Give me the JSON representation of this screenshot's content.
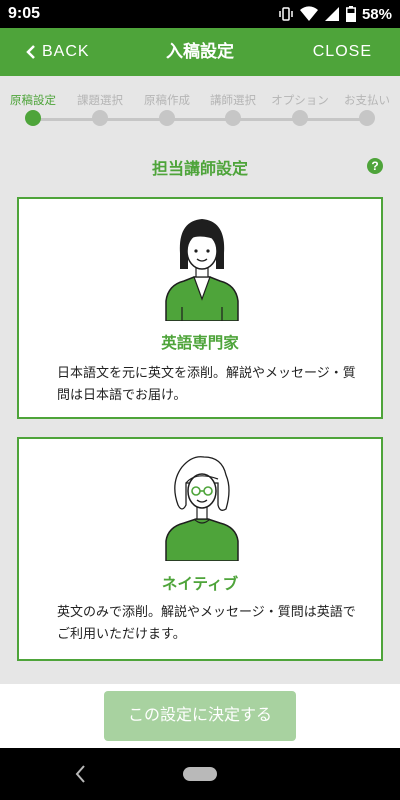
{
  "status_bar": {
    "time": "9:05",
    "battery": "58%"
  },
  "app_bar": {
    "back_label": "BACK",
    "title": "入稿設定",
    "close_label": "CLOSE"
  },
  "steps": [
    {
      "label": "原稿設定",
      "active": true
    },
    {
      "label": "課題選択",
      "active": false
    },
    {
      "label": "原稿作成",
      "active": false
    },
    {
      "label": "講師選択",
      "active": false
    },
    {
      "label": "オプション",
      "active": false
    },
    {
      "label": "お支払い",
      "active": false
    }
  ],
  "section": {
    "title": "担当講師設定",
    "help_icon": "?"
  },
  "options": [
    {
      "title": "英語専門家",
      "description": "日本語文を元に英文を添削。解説やメッセージ・質問は日本語でお届け。",
      "avatar": "female-teacher-avatar"
    },
    {
      "title": "ネイティブ",
      "description": "英文のみで添削。解説やメッセージ・質問は英語でご利用いただけます。",
      "avatar": "native-teacher-avatar"
    }
  ],
  "submit": {
    "label": "この設定に決定する"
  },
  "colors": {
    "accent": "#4ea43a",
    "disabled_button": "#a8d2a0",
    "background": "#e6e6e6"
  }
}
